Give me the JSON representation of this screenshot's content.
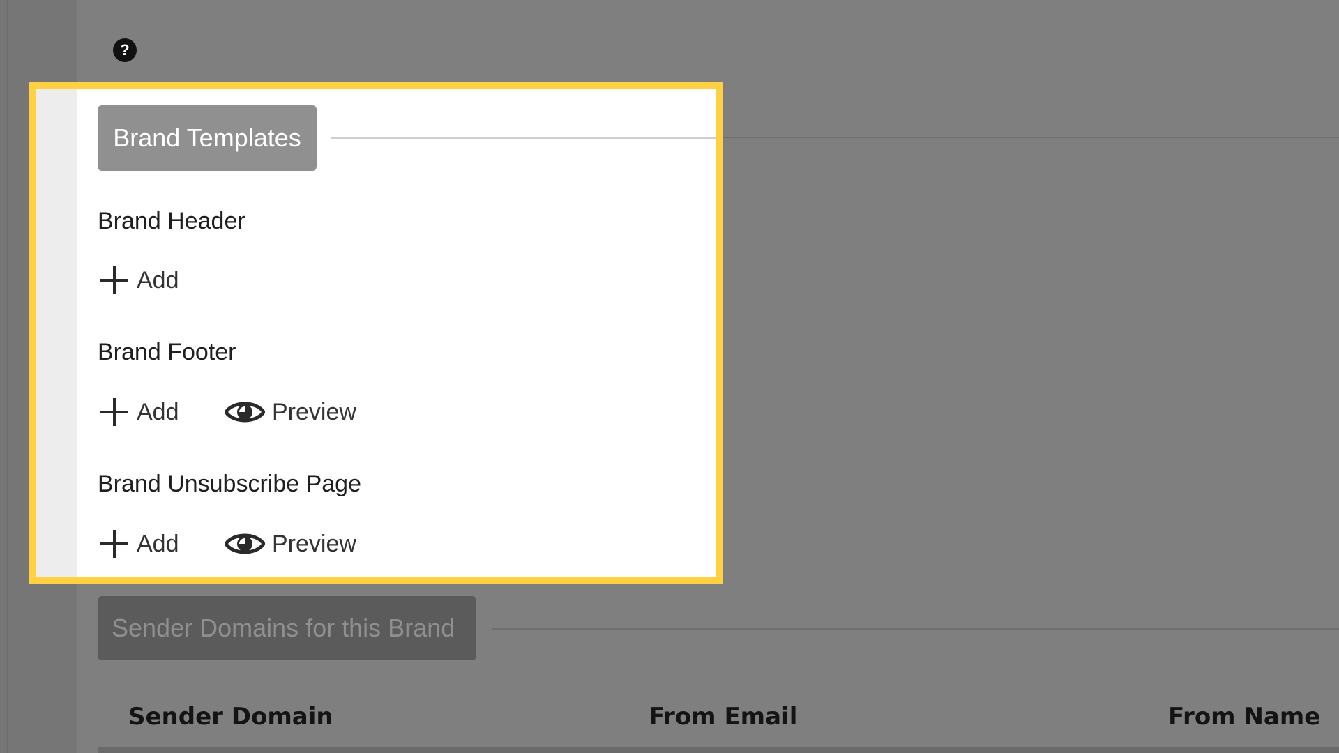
{
  "help": {
    "glyph": "?"
  },
  "brand_templates": {
    "title": "Brand Templates",
    "sections": [
      {
        "label": "Brand Header",
        "actions": [
          "Add"
        ]
      },
      {
        "label": "Brand Footer",
        "actions": [
          "Add",
          "Preview"
        ]
      },
      {
        "label": "Brand Unsubscribe Page",
        "actions": [
          "Add",
          "Preview"
        ]
      }
    ]
  },
  "sender_domains": {
    "title": "Sender Domains for this Brand",
    "columns": [
      "Sender Domain",
      "From Email",
      "From Name"
    ]
  },
  "colors": {
    "overlay": "#7f7f7f",
    "highlight_border": "#ffd041",
    "pill_active": "#909090",
    "pill_dim": "#5b5b5b"
  }
}
